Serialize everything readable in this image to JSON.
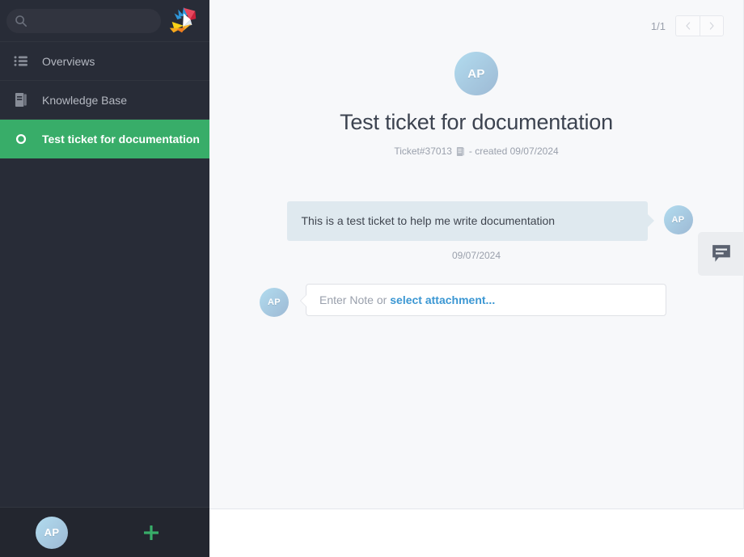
{
  "sidebar": {
    "search": {
      "name": "search-input",
      "placeholder": "",
      "value": ""
    },
    "logo_name": "zammad-bird-logo",
    "items": [
      {
        "label": "Overviews",
        "icon": "list-icon",
        "active": false
      },
      {
        "label": "Knowledge Base",
        "icon": "book-icon",
        "active": false
      },
      {
        "label": "Test ticket for documentation",
        "icon": "ticket-state-circle-icon",
        "active": true
      }
    ],
    "bottom": {
      "avatar_initials": "AP",
      "add_label": "+"
    }
  },
  "main": {
    "pager": {
      "count": "1/1",
      "prev_label": "‹",
      "next_label": "›"
    },
    "ticket": {
      "avatar_initials": "AP",
      "title": "Test ticket for documentation",
      "number_label": "Ticket#37013",
      "copy_icon": "document-copy-icon",
      "created_label": "- created 09/07/2024"
    },
    "article": {
      "avatar_initials": "AP",
      "body": "This is a test ticket to help me write documentation",
      "date": "09/07/2024"
    },
    "composer": {
      "avatar_initials": "AP",
      "placeholder_text": "Enter Note or",
      "attachment_link": "select attachment...",
      "value": ""
    },
    "chat_tab": {
      "icon": "chat-bubble-icon"
    }
  },
  "colors": {
    "sidebar_bg": "#282c37",
    "sidebar_bottom_bg": "#23262f",
    "active_green": "#38ad69",
    "content_bg": "#f7f8fa",
    "bubble_bg": "#dfe9ef",
    "link_blue": "#3b97d3",
    "add_green": "#38ad69"
  }
}
